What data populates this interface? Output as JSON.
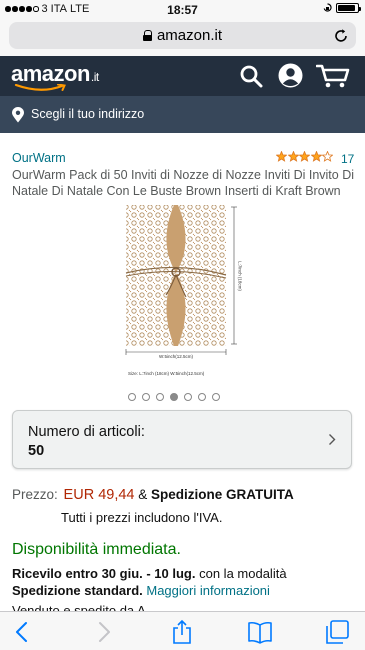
{
  "status_bar": {
    "carrier": "3 ITA",
    "network": "LTE",
    "time": "18:57",
    "battery_level": 0.9
  },
  "browser": {
    "url": "amazon.it"
  },
  "header": {
    "logo_text": "amazon",
    "logo_tld": ".it",
    "address_prompt": "Scegli il tuo indirizzo"
  },
  "product": {
    "brand": "OurWarm",
    "rating": 4.0,
    "rating_count": "17",
    "title": "OurWarm Pack di 50 Inviti di Nozze di Nozze Inviti Di Invito Di Natale Di Natale Con Le Buste Brown Inserti di Kraft Brown",
    "image_labels": {
      "width_label": "W:5inch(12.5cm)",
      "height_label": "L:7inch (18cm)",
      "size_caption": "Size:  L:7inch (18cm)  W:5inch(12.5cm)"
    },
    "image_count": 7,
    "active_image_index": 3
  },
  "quantity": {
    "label": "Numero di articoli:",
    "value": "50"
  },
  "price": {
    "label": "Prezzo:",
    "value": "EUR 49,44",
    "shipping_prefix": "& ",
    "shipping": "Spedizione GRATUITA",
    "vat_note": "Tutti i prezzi includono l'IVA."
  },
  "availability": {
    "status": "Disponibilità immediata.",
    "delivery_prefix": "Ricevilo entro 30 giu. - 10 lug.",
    "delivery_middle": " con la modalità ",
    "delivery_method": "Spedizione standard.",
    "more_info": "Maggiori informazioni",
    "cut_off_text": "Venduto e spedito da A"
  },
  "colors": {
    "amazon_dark": "#232f3e",
    "amazon_addr": "#37475a",
    "link": "#007185",
    "price": "#b12704",
    "in_stock": "#007600",
    "star": "#ffa41c",
    "ios_blue": "#007aff"
  }
}
